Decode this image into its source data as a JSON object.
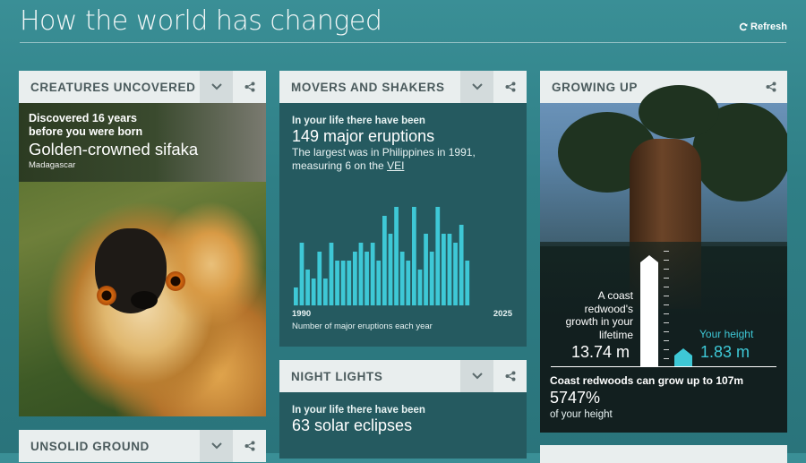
{
  "page": {
    "title": "How the world has changed",
    "refresh_label": "Refresh"
  },
  "creatures": {
    "header": "CREATURES UNCOVERED",
    "line1": "Discovered 16 years",
    "line2": "before you were born",
    "name": "Golden-crowned sifaka",
    "place": "Madagascar"
  },
  "movers": {
    "header": "MOVERS AND SHAKERS",
    "intro": "In your life there have been",
    "big": "149 major eruptions",
    "detail1": "The largest was in Philippines in 1991,",
    "detail2_prefix": "measuring 6 on the ",
    "detail2_link": "VEI",
    "caption": "Number of major eruptions each year",
    "chart_data": {
      "type": "bar",
      "x_start_label": "1990",
      "x_end_label": "2025",
      "values": [
        2,
        7,
        4,
        3,
        6,
        3,
        7,
        5,
        5,
        5,
        6,
        7,
        6,
        7,
        5,
        10,
        8,
        11,
        6,
        5,
        11,
        4,
        8,
        6,
        11,
        8,
        8,
        7,
        9,
        5
      ],
      "ylim": [
        0,
        12
      ],
      "color": "#3ec8d6"
    }
  },
  "night": {
    "header": "NIGHT LIGHTS",
    "intro": "In your life there have been",
    "big": "63 solar eclipses"
  },
  "growing": {
    "header": "GROWING UP",
    "text_l1": "A coast",
    "text_l2": "redwood's",
    "text_l3": "growth in your",
    "text_l4": "lifetime",
    "tree_growth": "13.74 m",
    "height_label": "Your height",
    "height_value": "1.83 m",
    "note": "Coast redwoods can grow up to 107m",
    "percent": "5747%",
    "of_height": "of your height",
    "accent": "#3ec8d6"
  },
  "unsolid": {
    "header": "UNSOLID GROUND"
  }
}
